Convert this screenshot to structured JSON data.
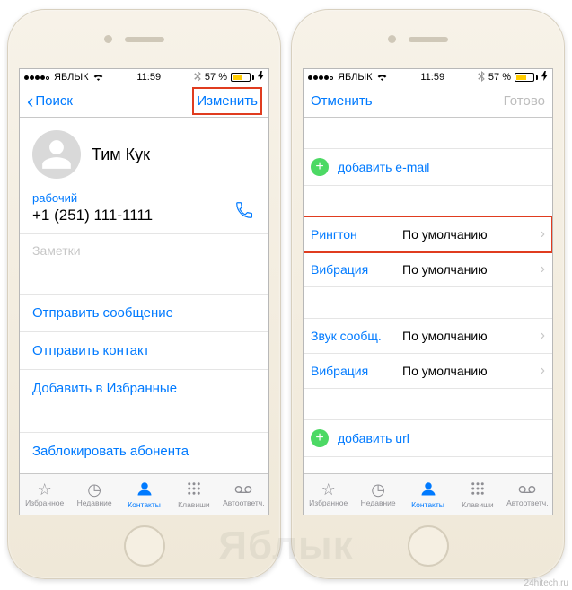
{
  "status": {
    "carrier": "ЯБЛЫК",
    "time": "11:59",
    "battery_pct": "57 %"
  },
  "left": {
    "nav_back": "Поиск",
    "nav_edit": "Изменить",
    "contact_name": "Тим Кук",
    "phone_label": "рабочий",
    "phone_number": "+1 (251) 111-1111",
    "notes_placeholder": "Заметки",
    "actions": {
      "send_message": "Отправить сообщение",
      "send_contact": "Отправить контакт",
      "add_favorite": "Добавить в Избранные",
      "block": "Заблокировать абонента"
    }
  },
  "right": {
    "nav_cancel": "Отменить",
    "nav_done": "Готово",
    "add_email": "добавить e-mail",
    "ringtone_label": "Рингтон",
    "ringtone_value": "По умолчанию",
    "vibration_label": "Вибрация",
    "vibration_value": "По умолчанию",
    "msg_sound_label": "Звук сообщ.",
    "msg_sound_value": "По умолчанию",
    "msg_vibration_label": "Вибрация",
    "msg_vibration_value": "По умолчанию",
    "add_url": "добавить url"
  },
  "tabs": {
    "favorites": "Избранное",
    "recents": "Недавние",
    "contacts": "Контакты",
    "keypad": "Клавиши",
    "voicemail": "Автоответч."
  },
  "watermark": "Яблык",
  "credit": "24hitech.ru"
}
